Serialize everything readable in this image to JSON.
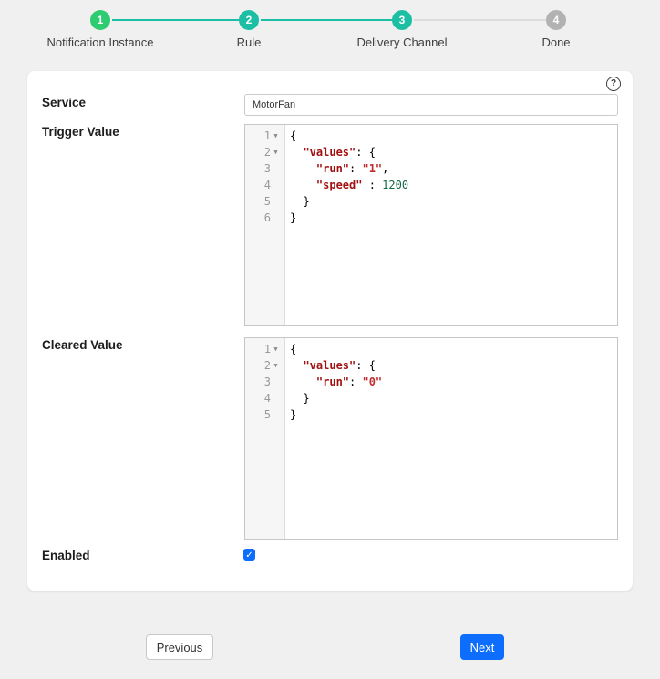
{
  "stepper": {
    "steps": [
      {
        "number": "1",
        "label": "Notification Instance",
        "state": "done"
      },
      {
        "number": "2",
        "label": "Rule",
        "state": "active"
      },
      {
        "number": "3",
        "label": "Delivery Channel",
        "state": "active"
      },
      {
        "number": "4",
        "label": "Done",
        "state": "pending"
      }
    ],
    "colors": {
      "done": "#2dcc70",
      "active": "#1cbfa4",
      "pending": "#b2b2b2",
      "connector_active": "#1cbfa4",
      "connector_pending": "#dcdcdc"
    }
  },
  "form": {
    "help_icon": "?",
    "service": {
      "label": "Service",
      "value": "MotorFan"
    },
    "trigger": {
      "label": "Trigger Value",
      "lines": [
        {
          "num": "1",
          "fold": true,
          "segments": [
            {
              "t": "{",
              "c": "p"
            }
          ]
        },
        {
          "num": "2",
          "fold": true,
          "segments": [
            {
              "t": "  ",
              "c": "p"
            },
            {
              "t": "\"values\"",
              "c": "k"
            },
            {
              "t": ": ",
              "c": "p"
            },
            {
              "t": "{",
              "c": "p"
            }
          ]
        },
        {
          "num": "3",
          "fold": false,
          "segments": [
            {
              "t": "    ",
              "c": "p"
            },
            {
              "t": "\"run\"",
              "c": "k"
            },
            {
              "t": ": ",
              "c": "p"
            },
            {
              "t": "\"1\"",
              "c": "s"
            },
            {
              "t": ",",
              "c": "p"
            }
          ]
        },
        {
          "num": "4",
          "fold": false,
          "segments": [
            {
              "t": "    ",
              "c": "p"
            },
            {
              "t": "\"speed\"",
              "c": "k"
            },
            {
              "t": " : ",
              "c": "p"
            },
            {
              "t": "1200",
              "c": "n"
            }
          ]
        },
        {
          "num": "5",
          "fold": false,
          "segments": [
            {
              "t": "  }",
              "c": "p"
            }
          ]
        },
        {
          "num": "6",
          "fold": false,
          "segments": [
            {
              "t": "}",
              "c": "p"
            }
          ]
        }
      ]
    },
    "cleared": {
      "label": "Cleared Value",
      "lines": [
        {
          "num": "1",
          "fold": true,
          "segments": [
            {
              "t": "{",
              "c": "p"
            }
          ]
        },
        {
          "num": "2",
          "fold": true,
          "segments": [
            {
              "t": "  ",
              "c": "p"
            },
            {
              "t": "\"values\"",
              "c": "k"
            },
            {
              "t": ": ",
              "c": "p"
            },
            {
              "t": "{",
              "c": "p"
            }
          ]
        },
        {
          "num": "3",
          "fold": false,
          "segments": [
            {
              "t": "    ",
              "c": "p"
            },
            {
              "t": "\"run\"",
              "c": "k"
            },
            {
              "t": ": ",
              "c": "p"
            },
            {
              "t": "\"0\"",
              "c": "s"
            }
          ]
        },
        {
          "num": "4",
          "fold": false,
          "segments": [
            {
              "t": "  }",
              "c": "p"
            }
          ]
        },
        {
          "num": "5",
          "fold": false,
          "segments": [
            {
              "t": "}",
              "c": "p"
            }
          ]
        }
      ]
    },
    "enabled": {
      "label": "Enabled",
      "checked": true,
      "check_glyph": "✓"
    }
  },
  "buttons": {
    "previous": "Previous",
    "next": "Next"
  },
  "syntax_colors": {
    "key": "#a11111",
    "string": "#c22c2c",
    "number": "#116644",
    "plain": "#000000"
  },
  "accent_colors": {
    "primary_button": "#0d6efd",
    "checkbox": "#0d6efd"
  }
}
